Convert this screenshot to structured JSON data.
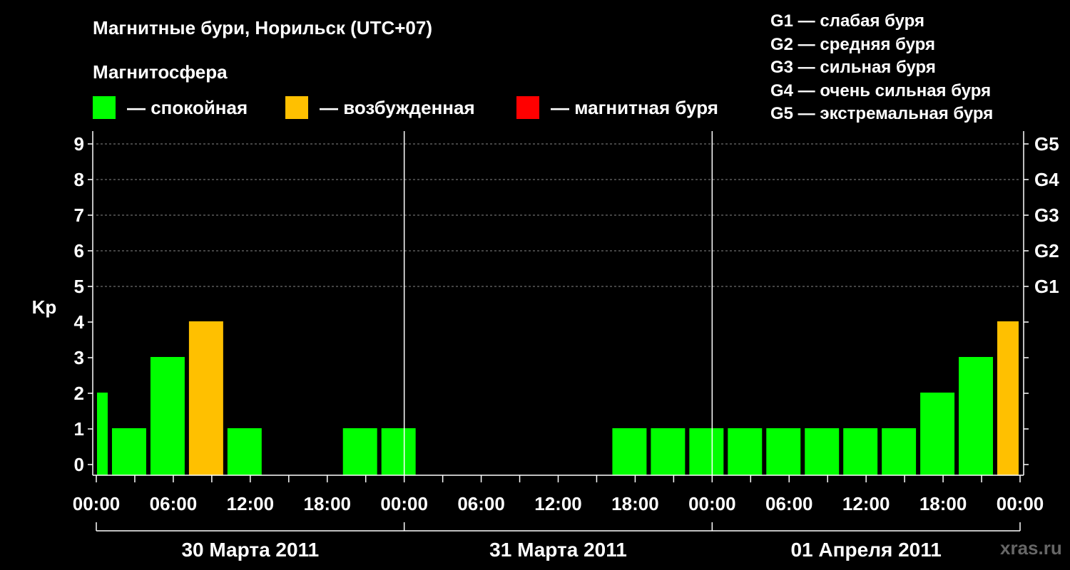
{
  "title": "Магнитные бури, Норильск (UTC+07)",
  "subtitle": "Магнитосфера",
  "legend": [
    {
      "label": "— спокойная",
      "color": "#00ff00"
    },
    {
      "label": "— возбужденная",
      "color": "#ffc000"
    },
    {
      "label": "— магнитная буря",
      "color": "#ff0000"
    }
  ],
  "g_scale": [
    "G1 — слабая буря",
    "G2 — средняя буря",
    "G3 — сильная буря",
    "G4 — очень сильная буря",
    "G5 — экстремальная буря"
  ],
  "watermark": "xras.ru",
  "chart_data": {
    "type": "bar",
    "ylabel": "Kp",
    "ylim": [
      0,
      9
    ],
    "yticks": [
      "0",
      "1",
      "2",
      "3",
      "4",
      "5",
      "6",
      "7",
      "8",
      "9"
    ],
    "right_ticks": [
      {
        "value": 5,
        "label": "G1"
      },
      {
        "value": 6,
        "label": "G2"
      },
      {
        "value": 7,
        "label": "G3"
      },
      {
        "value": 8,
        "label": "G4"
      },
      {
        "value": 9,
        "label": "G5"
      }
    ],
    "xtick_labels": [
      "00:00",
      "06:00",
      "12:00",
      "18:00",
      "00:00",
      "06:00",
      "12:00",
      "18:00",
      "00:00",
      "06:00",
      "12:00",
      "18:00",
      "00:00"
    ],
    "days": [
      "30 Марта 2011",
      "31 Марта 2011",
      "01 Апреля 2011"
    ],
    "grid": "dashed horizontal at Kp 5–9",
    "bars": [
      {
        "start_hour": 0,
        "end_hour": 1,
        "kp": 2,
        "state": "спокойная",
        "color": "#00ff00"
      },
      {
        "start_hour": 1,
        "end_hour": 4,
        "kp": 1,
        "state": "спокойная",
        "color": "#00ff00"
      },
      {
        "start_hour": 4,
        "end_hour": 7,
        "kp": 3,
        "state": "спокойная",
        "color": "#00ff00"
      },
      {
        "start_hour": 7,
        "end_hour": 10,
        "kp": 4,
        "state": "возбужденная",
        "color": "#ffc000"
      },
      {
        "start_hour": 10,
        "end_hour": 13,
        "kp": 1,
        "state": "спокойная",
        "color": "#00ff00"
      },
      {
        "start_hour": 13,
        "end_hour": 16,
        "kp": 0,
        "state": "спокойная",
        "color": "#00ff00"
      },
      {
        "start_hour": 16,
        "end_hour": 19,
        "kp": 0,
        "state": "спокойная",
        "color": "#00ff00"
      },
      {
        "start_hour": 19,
        "end_hour": 22,
        "kp": 1,
        "state": "спокойная",
        "color": "#00ff00"
      },
      {
        "start_hour": 22,
        "end_hour": 25,
        "kp": 1,
        "state": "спокойная",
        "color": "#00ff00"
      },
      {
        "start_hour": 25,
        "end_hour": 28,
        "kp": 0,
        "state": "спокойная",
        "color": "#00ff00"
      },
      {
        "start_hour": 28,
        "end_hour": 31,
        "kp": 0,
        "state": "спокойная",
        "color": "#00ff00"
      },
      {
        "start_hour": 31,
        "end_hour": 34,
        "kp": 0,
        "state": "спокойная",
        "color": "#00ff00"
      },
      {
        "start_hour": 34,
        "end_hour": 37,
        "kp": 0,
        "state": "спокойная",
        "color": "#00ff00"
      },
      {
        "start_hour": 37,
        "end_hour": 40,
        "kp": 0,
        "state": "спокойная",
        "color": "#00ff00"
      },
      {
        "start_hour": 40,
        "end_hour": 43,
        "kp": 1,
        "state": "спокойная",
        "color": "#00ff00"
      },
      {
        "start_hour": 43,
        "end_hour": 46,
        "kp": 1,
        "state": "спокойная",
        "color": "#00ff00"
      },
      {
        "start_hour": 46,
        "end_hour": 49,
        "kp": 1,
        "state": "спокойная",
        "color": "#00ff00"
      },
      {
        "start_hour": 49,
        "end_hour": 52,
        "kp": 1,
        "state": "спокойная",
        "color": "#00ff00"
      },
      {
        "start_hour": 52,
        "end_hour": 55,
        "kp": 1,
        "state": "спокойная",
        "color": "#00ff00"
      },
      {
        "start_hour": 55,
        "end_hour": 58,
        "kp": 1,
        "state": "спокойная",
        "color": "#00ff00"
      },
      {
        "start_hour": 58,
        "end_hour": 61,
        "kp": 1,
        "state": "спокойная",
        "color": "#00ff00"
      },
      {
        "start_hour": 61,
        "end_hour": 64,
        "kp": 1,
        "state": "спокойная",
        "color": "#00ff00"
      },
      {
        "start_hour": 64,
        "end_hour": 67,
        "kp": 2,
        "state": "спокойная",
        "color": "#00ff00"
      },
      {
        "start_hour": 67,
        "end_hour": 70,
        "kp": 3,
        "state": "спокойная",
        "color": "#00ff00"
      },
      {
        "start_hour": 70,
        "end_hour": 72,
        "kp": 4,
        "state": "возбужденная",
        "color": "#ffc000"
      }
    ]
  }
}
